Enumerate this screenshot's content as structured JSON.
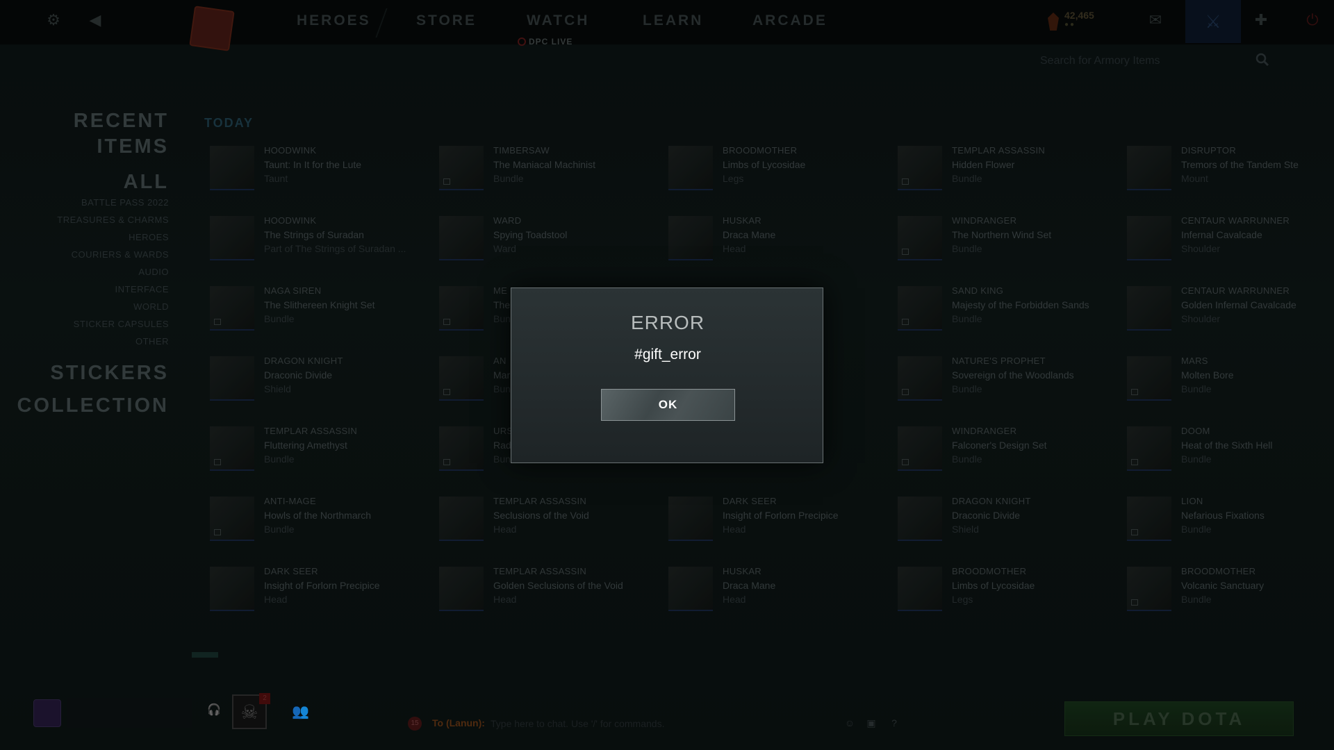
{
  "nav": {
    "items": [
      "HEROES",
      "STORE",
      "WATCH",
      "LEARN",
      "ARCADE"
    ],
    "dpc_live": "DPC LIVE",
    "shards_value": "42,465",
    "shards_sub": "●●"
  },
  "search": {
    "placeholder": "Search for Armory Items"
  },
  "sidebar": {
    "recent_heading_1": "RECENT",
    "recent_heading_2": "ITEMS",
    "all_heading": "ALL",
    "categories": [
      "BATTLE PASS 2022",
      "TREASURES & CHARMS",
      "HEROES",
      "COURIERS & WARDS",
      "AUDIO",
      "INTERFACE",
      "WORLD",
      "STICKER CAPSULES",
      "OTHER"
    ],
    "stickers_heading": "STICKERS",
    "collection_heading": "COLLECTION"
  },
  "content": {
    "section_label": "TODAY",
    "items": [
      [
        {
          "hero": "HOODWINK",
          "name": "Taunt: In It for the Lute",
          "slot": "Taunt"
        },
        {
          "hero": "TIMBERSAW",
          "name": "The Maniacal Machinist",
          "slot": "Bundle"
        },
        {
          "hero": "BROODMOTHER",
          "name": "Limbs of Lycosidae",
          "slot": "Legs"
        },
        {
          "hero": "TEMPLAR ASSASSIN",
          "name": "Hidden Flower",
          "slot": "Bundle"
        },
        {
          "hero": "DISRUPTOR",
          "name": "Tremors of the Tandem Ste",
          "slot": "Mount"
        }
      ],
      [
        {
          "hero": "HOODWINK",
          "name": "The Strings of Suradan",
          "slot": "Part of The Strings of Suradan ..."
        },
        {
          "hero": "WARD",
          "name": "Spying Toadstool",
          "slot": "Ward"
        },
        {
          "hero": "HUSKAR",
          "name": "Draca Mane",
          "slot": "Head"
        },
        {
          "hero": "WINDRANGER",
          "name": "The Northern Wind Set",
          "slot": "Bundle"
        },
        {
          "hero": "CENTAUR WARRUNNER",
          "name": "Infernal Cavalcade",
          "slot": "Shoulder"
        }
      ],
      [
        {
          "hero": "NAGA SIREN",
          "name": "The Slithereen Knight Set",
          "slot": "Bundle"
        },
        {
          "hero": "ME",
          "name": "The",
          "slot": "Bun"
        },
        {
          "hero": "",
          "name": "",
          "slot": ""
        },
        {
          "hero": "SAND KING",
          "name": "Majesty of the Forbidden Sands",
          "slot": "Bundle"
        },
        {
          "hero": "CENTAUR WARRUNNER",
          "name": "Golden Infernal Cavalcade",
          "slot": "Shoulder"
        }
      ],
      [
        {
          "hero": "DRAGON KNIGHT",
          "name": "Draconic Divide",
          "slot": "Shield"
        },
        {
          "hero": "AN",
          "name": "Mar",
          "slot": "Bun"
        },
        {
          "hero": "",
          "name": "",
          "slot": ""
        },
        {
          "hero": "NATURE'S PROPHET",
          "name": "Sovereign of the Woodlands",
          "slot": "Bundle"
        },
        {
          "hero": "MARS",
          "name": "Molten Bore",
          "slot": "Bundle"
        }
      ],
      [
        {
          "hero": "TEMPLAR ASSASSIN",
          "name": "Fluttering Amethyst",
          "slot": "Bundle"
        },
        {
          "hero": "URS",
          "name": "Rad",
          "slot": "Bundle"
        },
        {
          "hero": "",
          "name": "",
          "slot": ""
        },
        {
          "hero": "WINDRANGER",
          "name": "Falconer's Design Set",
          "slot": "Bundle"
        },
        {
          "hero": "DOOM",
          "name": "Heat of the Sixth Hell",
          "slot": "Bundle"
        }
      ],
      [
        {
          "hero": "ANTI-MAGE",
          "name": "Howls of the Northmarch",
          "slot": "Bundle"
        },
        {
          "hero": "TEMPLAR ASSASSIN",
          "name": "Seclusions of the Void",
          "slot": "Head"
        },
        {
          "hero": "DARK SEER",
          "name": "Insight of Forlorn Precipice",
          "slot": "Head"
        },
        {
          "hero": "DRAGON KNIGHT",
          "name": "Draconic Divide",
          "slot": "Shield"
        },
        {
          "hero": "LION",
          "name": "Nefarious Fixations",
          "slot": "Bundle"
        }
      ],
      [
        {
          "hero": "DARK SEER",
          "name": "Insight of Forlorn Precipice",
          "slot": "Head"
        },
        {
          "hero": "TEMPLAR ASSASSIN",
          "name": "Golden Seclusions of the Void",
          "slot": "Head"
        },
        {
          "hero": "HUSKAR",
          "name": "Draca Mane",
          "slot": "Head"
        },
        {
          "hero": "BROODMOTHER",
          "name": "Limbs of Lycosidae",
          "slot": "Legs"
        },
        {
          "hero": "BROODMOTHER",
          "name": "Volcanic Sanctuary",
          "slot": "Bundle"
        }
      ]
    ]
  },
  "bottom": {
    "guild_badge": "2",
    "chat_channel_count": "15",
    "chat_target": "To (Lanun):",
    "chat_placeholder": "Type here to chat. Use '/' for commands.",
    "play_label": "PLAY DOTA"
  },
  "dialog": {
    "title": "ERROR",
    "message": "#gift_error",
    "ok_label": "OK"
  }
}
